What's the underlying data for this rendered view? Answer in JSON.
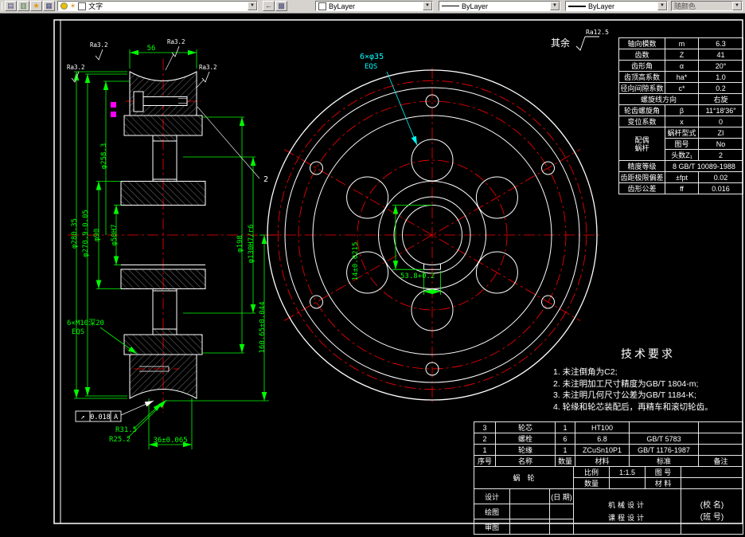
{
  "toolbar": {
    "layer_value": "文字",
    "color_value": "ByLayer",
    "linetype_value": "ByLayer",
    "lineweight_value": "ByLayer",
    "plotstyle_value": "随颜色"
  },
  "notes": {
    "qiyu": "其余",
    "ra_default": "Ra12.5",
    "ra_fine": "Ra3.2"
  },
  "tech_req": {
    "title": "技术要求",
    "items": [
      "1. 未注倒角为C2;",
      "2. 未注明加工尺寸精度为GB/T 1804-m;",
      "3. 未注明几何尺寸公差为GB/T 1184-K;",
      "4. 轮缘和轮芯装配后，再精车和滚切轮齿。"
    ]
  },
  "section_dims": {
    "width": "56",
    "od": "φ280.35",
    "tip_d": "φ270.9-0.05",
    "ref_d": "φ258.3",
    "hub_d": "φ90",
    "bore": "φ50H7",
    "flange_d": "φ198",
    "fit_d": "φ130H7/r6",
    "center_dist": "160.65±0.044",
    "tapped_holes": "6×M10深20",
    "tapped_eqs": "EQS",
    "throat_r_outer": "R31.5",
    "throat_r": "R25.2",
    "hub_len": "36±0.065",
    "runout_sym": "↗",
    "runout_val": "0.018",
    "runout_datum": "A",
    "balloon_2": "2"
  },
  "front_dims": {
    "holes": "6×φ35",
    "holes_eqs": "EQS",
    "key_depth": "53.8+0.2",
    "key_width": "14±0.0215"
  },
  "param_table": {
    "r1": [
      "轴向模数",
      "m",
      "6.3"
    ],
    "r2": [
      "齿数",
      "Z",
      "41"
    ],
    "r3": [
      "齿形角",
      "α",
      "20°"
    ],
    "r4": [
      "齿顶高系数",
      "ha*",
      "1.0"
    ],
    "r5": [
      "径向间隙系数",
      "c*",
      "0.2"
    ],
    "r6": [
      "螺旋线方向",
      "右旋"
    ],
    "r7": [
      "轮齿螺旋角",
      "β",
      "11°18′36″"
    ],
    "r8": [
      "变位系数",
      "x",
      "0"
    ],
    "r9_head": "配偶蜗杆",
    "r9": [
      "蜗杆型式",
      "ZI"
    ],
    "r10": [
      "图号",
      "No"
    ],
    "r11": [
      "头数Z₁",
      "2"
    ],
    "r12": [
      "精度等级",
      "8 GB/T 10089-1988"
    ],
    "r13": [
      "齿距极限偏差",
      "±fpt",
      "0.02"
    ],
    "r14": [
      "齿形公差",
      "ff",
      "0.016"
    ]
  },
  "parts_list": {
    "header": [
      "序号",
      "名称",
      "数量",
      "材料",
      "标准",
      "备注"
    ],
    "rows": [
      [
        "3",
        "轮芯",
        "1",
        "HT100",
        "",
        ""
      ],
      [
        "2",
        "螺栓",
        "6",
        "6.8",
        "GB/T 5783",
        ""
      ],
      [
        "1",
        "轮缘",
        "1",
        "ZCuSn10P1",
        "GB/T 1176-1987",
        ""
      ]
    ]
  },
  "title_block": {
    "part_name": "蜗轮",
    "scale_label": "比例",
    "scale_value": "1:1.5",
    "qty_label": "数量",
    "qty_value": "",
    "drawno_label": "图 号",
    "material_label": "材 料",
    "design_label": "设计",
    "draw_label": "绘图",
    "check_label": "审图",
    "date_label": "(日 期)",
    "course_line1": "机械设计",
    "course_line2": "课程设计",
    "school_label": "(校 名)",
    "class_label": "(班 号)"
  },
  "colors": {
    "line": "#ffffff",
    "center": "#ff0000",
    "dim": "#00ff00",
    "leader": "#00ffff",
    "grip": "#ff00ff",
    "canvas": "#000000",
    "toolbar": "#d6d3ce"
  }
}
